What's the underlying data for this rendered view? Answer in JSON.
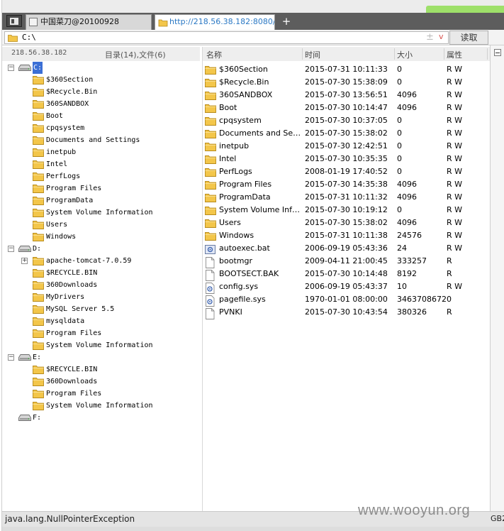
{
  "tabs": [
    {
      "label": "中国菜刀@20100928"
    },
    {
      "label": "http://218.56.38.182:8080/h..."
    }
  ],
  "new_tab_symbol": "+",
  "address": {
    "value": "C:\\",
    "plus_symbol": "±",
    "dropdown_symbol": "v",
    "read_button": "读取"
  },
  "left_pane": {
    "host_ip": "218.56.38.182",
    "counts": "目录(14),文件(6)",
    "tree": [
      {
        "label": "C:",
        "type": "drive",
        "expander": "−",
        "selected": true
      },
      {
        "label": "$360Section",
        "type": "folder"
      },
      {
        "label": "$Recycle.Bin",
        "type": "folder"
      },
      {
        "label": "360SANDBOX",
        "type": "folder"
      },
      {
        "label": "Boot",
        "type": "folder"
      },
      {
        "label": "cpqsystem",
        "type": "folder"
      },
      {
        "label": "Documents and Settings",
        "type": "folder"
      },
      {
        "label": "inetpub",
        "type": "folder"
      },
      {
        "label": "Intel",
        "type": "folder"
      },
      {
        "label": "PerfLogs",
        "type": "folder"
      },
      {
        "label": "Program Files",
        "type": "folder"
      },
      {
        "label": "ProgramData",
        "type": "folder"
      },
      {
        "label": "System Volume Information",
        "type": "folder"
      },
      {
        "label": "Users",
        "type": "folder"
      },
      {
        "label": "Windows",
        "type": "folder"
      },
      {
        "label": "D:",
        "type": "drive",
        "expander": "−"
      },
      {
        "label": "apache-tomcat-7.0.59",
        "type": "folder",
        "expander": "+"
      },
      {
        "label": "$RECYCLE.BIN",
        "type": "folder"
      },
      {
        "label": "360Downloads",
        "type": "folder"
      },
      {
        "label": "MyDrivers",
        "type": "folder"
      },
      {
        "label": "MySQL Server 5.5",
        "type": "folder"
      },
      {
        "label": "mysqldata",
        "type": "folder"
      },
      {
        "label": "Program Files",
        "type": "folder"
      },
      {
        "label": "System Volume Information",
        "type": "folder"
      },
      {
        "label": "E:",
        "type": "drive",
        "expander": "−"
      },
      {
        "label": "$RECYCLE.BIN",
        "type": "folder"
      },
      {
        "label": "360Downloads",
        "type": "folder"
      },
      {
        "label": "Program Files",
        "type": "folder"
      },
      {
        "label": "System Volume Information",
        "type": "folder"
      },
      {
        "label": "F:",
        "type": "drive"
      }
    ]
  },
  "right_pane": {
    "columns": {
      "name": "名称",
      "time": "时间",
      "size": "大小",
      "attr": "属性"
    },
    "files": [
      {
        "name": "$360Section",
        "time": "2015-07-31 10:11:33",
        "size": "0",
        "attr": "R W",
        "icon": "folder-icon"
      },
      {
        "name": "$Recycle.Bin",
        "time": "2015-07-30 15:38:09",
        "size": "0",
        "attr": "R W",
        "icon": "folder-icon"
      },
      {
        "name": "360SANDBOX",
        "time": "2015-07-30 13:56:51",
        "size": "4096",
        "attr": "R W",
        "icon": "folder-icon"
      },
      {
        "name": "Boot",
        "time": "2015-07-30 10:14:47",
        "size": "4096",
        "attr": "R W",
        "icon": "folder-icon"
      },
      {
        "name": "cpqsystem",
        "time": "2015-07-30 10:37:05",
        "size": "0",
        "attr": "R W",
        "icon": "folder-icon"
      },
      {
        "name": "Documents and Settings",
        "time": "2015-07-30 15:38:02",
        "size": "0",
        "attr": "R W",
        "icon": "folder-icon"
      },
      {
        "name": "inetpub",
        "time": "2015-07-30 12:42:51",
        "size": "0",
        "attr": "R W",
        "icon": "folder-icon"
      },
      {
        "name": "Intel",
        "time": "2015-07-30 10:35:35",
        "size": "0",
        "attr": "R W",
        "icon": "folder-icon"
      },
      {
        "name": "PerfLogs",
        "time": "2008-01-19 17:40:52",
        "size": "0",
        "attr": "R W",
        "icon": "folder-icon"
      },
      {
        "name": "Program Files",
        "time": "2015-07-30 14:35:38",
        "size": "4096",
        "attr": "R W",
        "icon": "folder-icon"
      },
      {
        "name": "ProgramData",
        "time": "2015-07-31 10:11:32",
        "size": "4096",
        "attr": "R W",
        "icon": "folder-icon"
      },
      {
        "name": "System Volume Inform...",
        "time": "2015-07-30 10:19:12",
        "size": "0",
        "attr": "R W",
        "icon": "folder-icon"
      },
      {
        "name": "Users",
        "time": "2015-07-30 15:38:02",
        "size": "4096",
        "attr": "R W",
        "icon": "folder-icon"
      },
      {
        "name": "Windows",
        "time": "2015-07-31 10:11:38",
        "size": "24576",
        "attr": "R W",
        "icon": "folder-icon"
      },
      {
        "name": "autoexec.bat",
        "time": "2006-09-19 05:43:36",
        "size": "24",
        "attr": "R W",
        "icon": "batch-file-icon"
      },
      {
        "name": "bootmgr",
        "time": "2009-04-11 21:00:45",
        "size": "333257",
        "attr": "R",
        "icon": "file-icon"
      },
      {
        "name": "BOOTSECT.BAK",
        "time": "2015-07-30 10:14:48",
        "size": "8192",
        "attr": "R",
        "icon": "file-icon"
      },
      {
        "name": "config.sys",
        "time": "2006-09-19 05:43:37",
        "size": "10",
        "attr": "R W",
        "icon": "system-file-icon"
      },
      {
        "name": "pagefile.sys",
        "time": "1970-01-01 08:00:00",
        "size": "34637086720",
        "attr": "",
        "icon": "system-file-icon"
      },
      {
        "name": "PVNKI",
        "time": "2015-07-30 10:43:54",
        "size": "380326",
        "attr": "R",
        "icon": "file-icon"
      }
    ]
  },
  "status": {
    "message": "java.lang.NullPointerException",
    "encoding": "GB2"
  },
  "watermark": "www.wooyun.org",
  "colors": {
    "selection": "#3b6fd5",
    "folder": "#f3c64a",
    "tab_link": "#2a78c4"
  }
}
